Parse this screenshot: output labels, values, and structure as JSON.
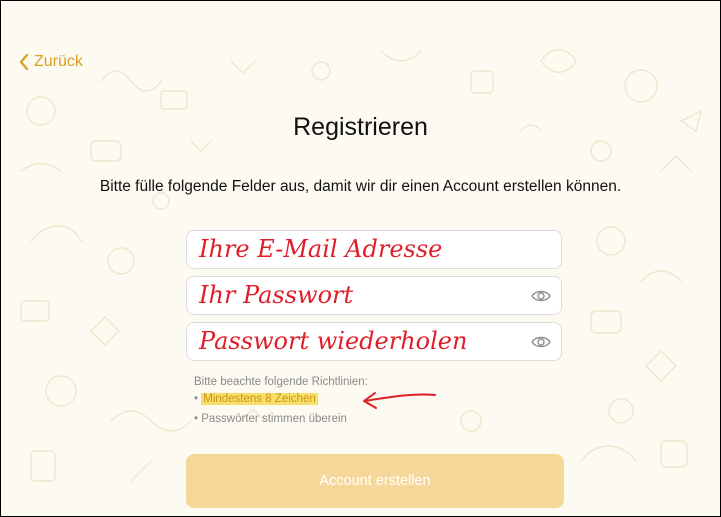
{
  "nav": {
    "back_label": "Zurück",
    "accent": "#d89f1c"
  },
  "header": {
    "title": "Registrieren",
    "subtitle": "Bitte fülle folgende Felder aus, damit wir dir einen Account erstellen können."
  },
  "form": {
    "email": {
      "handwritten": "Ihre E-Mail Adresse"
    },
    "password": {
      "handwritten": "Ihr Passwort",
      "icon": "eye-icon"
    },
    "password_repeat": {
      "handwritten": "Passwort wiederholen",
      "icon": "eye-icon"
    },
    "handwriting_color": "#e01e2a"
  },
  "rules": {
    "title": "Bitte beachte folgende Richtlinien:",
    "items": [
      "Mindestens 8 Zeichen",
      "Passwörter stimmen überein"
    ],
    "bullet": "•",
    "highlight_color": "#f8df6a"
  },
  "cta": {
    "label": "Account erstellen",
    "color": "#f5d79a"
  }
}
